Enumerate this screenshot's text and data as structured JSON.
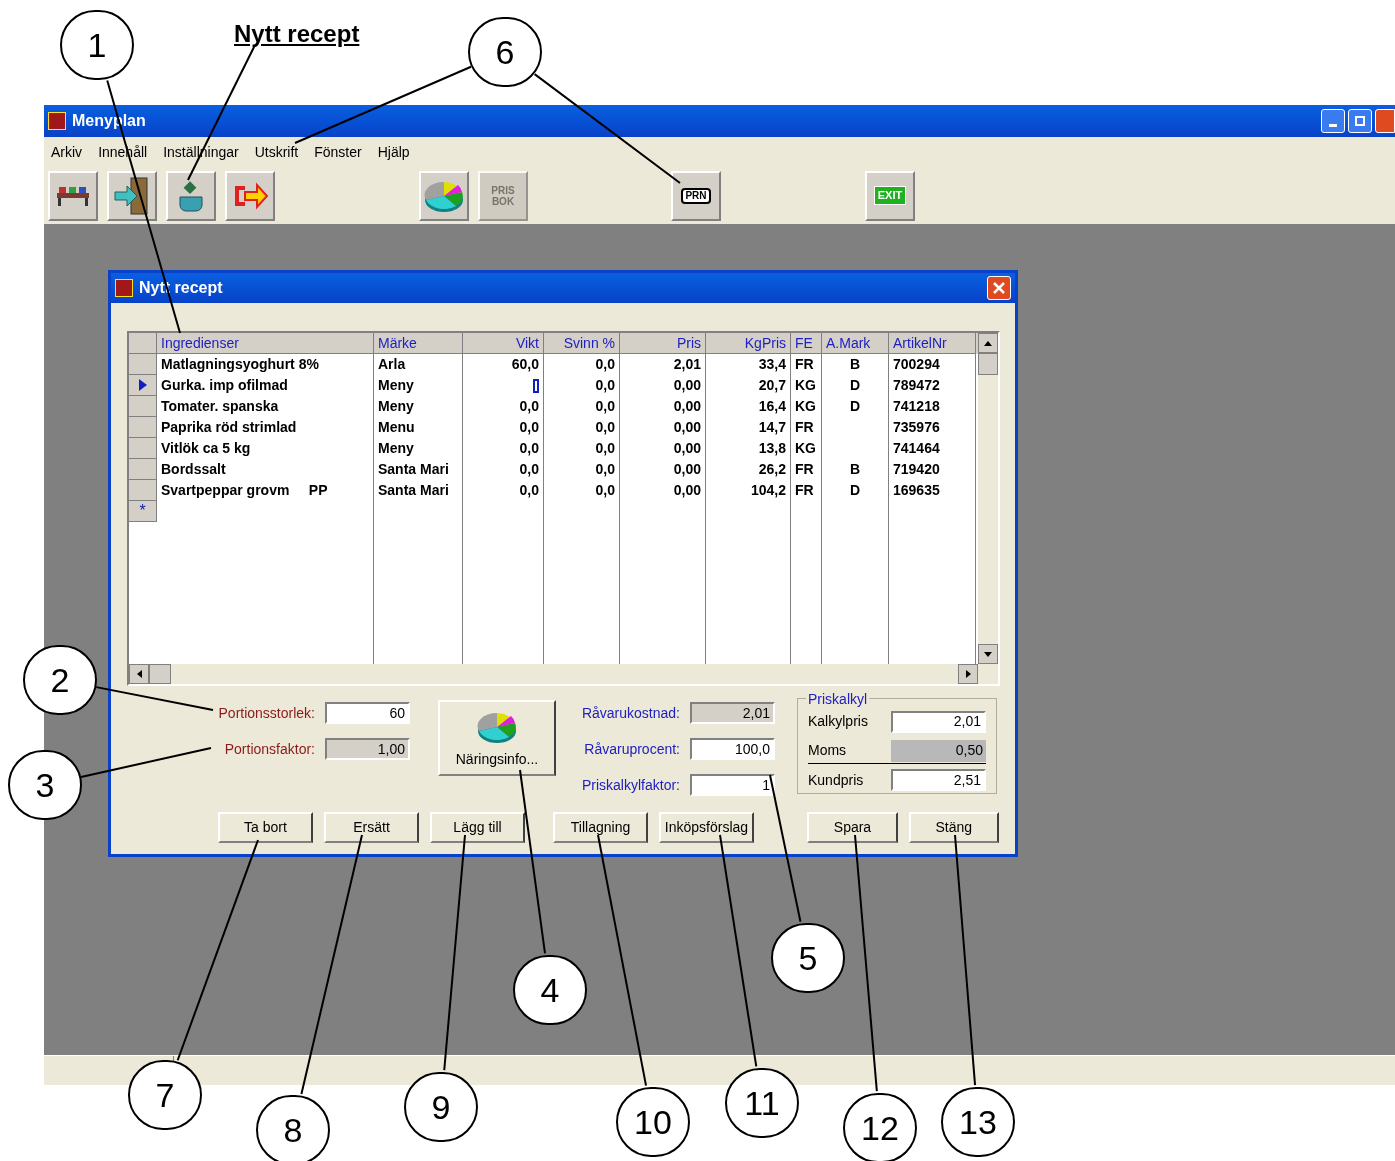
{
  "heading": "Nytt recept",
  "callouts": [
    {
      "number": "1"
    },
    {
      "number": "6"
    },
    {
      "number": "2"
    },
    {
      "number": "3"
    },
    {
      "number": "4"
    },
    {
      "number": "5"
    },
    {
      "number": "7"
    },
    {
      "number": "8"
    },
    {
      "number": "9"
    },
    {
      "number": "10"
    },
    {
      "number": "11"
    },
    {
      "number": "12"
    },
    {
      "number": "13"
    }
  ],
  "window": {
    "title": "Menyplan"
  },
  "menu": [
    "Arkiv",
    "Innehåll",
    "Inställningar",
    "Utskrift",
    "Fönster",
    "Hjälp"
  ],
  "toolbar": [
    {
      "kind": "tables",
      "disabled": false
    },
    {
      "kind": "door",
      "disabled": false
    },
    {
      "kind": "pot",
      "disabled": false
    },
    {
      "kind": "exit-arrow",
      "disabled": false
    },
    {
      "kind": "gap"
    },
    {
      "kind": "pie",
      "disabled": false
    },
    {
      "kind": "text",
      "text": "PRIS BOK",
      "disabled": true
    },
    {
      "kind": "gap"
    },
    {
      "kind": "printer",
      "text": "PRN",
      "disabled": false
    },
    {
      "kind": "gap"
    },
    {
      "kind": "exit",
      "text": "EXIT",
      "disabled": false
    }
  ],
  "dialog": {
    "title": "Nytt recept",
    "table": {
      "columns": [
        "Ingredienser",
        "Märke",
        "Vikt",
        "Svinn %",
        "Pris",
        "KgPris",
        "FE",
        "A.Mark",
        "ArtikelNr"
      ],
      "rows": [
        {
          "selected": false,
          "cells": [
            "Matlagningsyoghurt 8%",
            "Arla",
            "60,0",
            "0,0",
            "2,01",
            "33,4",
            "FR",
            "B",
            "700294"
          ]
        },
        {
          "selected": true,
          "cells": [
            "Gurka. imp ofilmad",
            "Meny",
            null,
            "0,0",
            "0,00",
            "20,7",
            "KG",
            "D",
            "789472"
          ]
        },
        {
          "selected": false,
          "cells": [
            "Tomater. spanska",
            "Meny",
            "0,0",
            "0,0",
            "0,00",
            "16,4",
            "KG",
            "D",
            "741218"
          ]
        },
        {
          "selected": false,
          "cells": [
            "Paprika röd strimlad",
            "Menu",
            "0,0",
            "0,0",
            "0,00",
            "14,7",
            "FR",
            null,
            "735976"
          ]
        },
        {
          "selected": false,
          "cells": [
            "Vitlök ca 5 kg",
            "Meny",
            "0,0",
            "0,0",
            "0,00",
            "13,8",
            "KG",
            null,
            "741464"
          ]
        },
        {
          "selected": false,
          "cells": [
            "Bordssalt",
            "Santa Mari",
            "0,0",
            "0,0",
            "0,00",
            "26,2",
            "FR",
            "B",
            "719420"
          ]
        },
        {
          "selected": false,
          "cells": [
            "Svartpeppar grovm     PP",
            "Santa Mari",
            "0,0",
            "0,0",
            "0,00",
            "104,2",
            "FR",
            "D",
            "169635"
          ]
        }
      ],
      "new_row_marker": "*"
    },
    "portion_fields": [
      {
        "label": "Portionsstorlek:",
        "value": "60",
        "editable": true
      },
      {
        "label": "Portionsfaktor:",
        "value": "1,00",
        "editable": false
      }
    ],
    "info_button": "Näringsinfo...",
    "cost_fields": [
      {
        "label": "Råvarukostnad:",
        "value": "2,01",
        "editable": false
      },
      {
        "label": "Råvaruprocent:",
        "value": "100,0",
        "editable": true
      },
      {
        "label": "Priskalkylfaktor:",
        "value": "1",
        "editable": true
      }
    ],
    "priskalkyl": {
      "title": "Priskalkyl",
      "fields": [
        {
          "label": "Kalkylpris",
          "value": "2,01",
          "editable": true
        },
        {
          "label": "Moms",
          "value": "0,50",
          "editable": false
        },
        {
          "label": "Kundpris",
          "value": "2,51",
          "editable": true
        }
      ]
    },
    "buttons_left": [
      "Ta bort",
      "Ersätt",
      "Lägg till",
      "Tillagning",
      "Inköpsförslag"
    ],
    "buttons_right": [
      "Spara",
      "Stäng"
    ]
  }
}
